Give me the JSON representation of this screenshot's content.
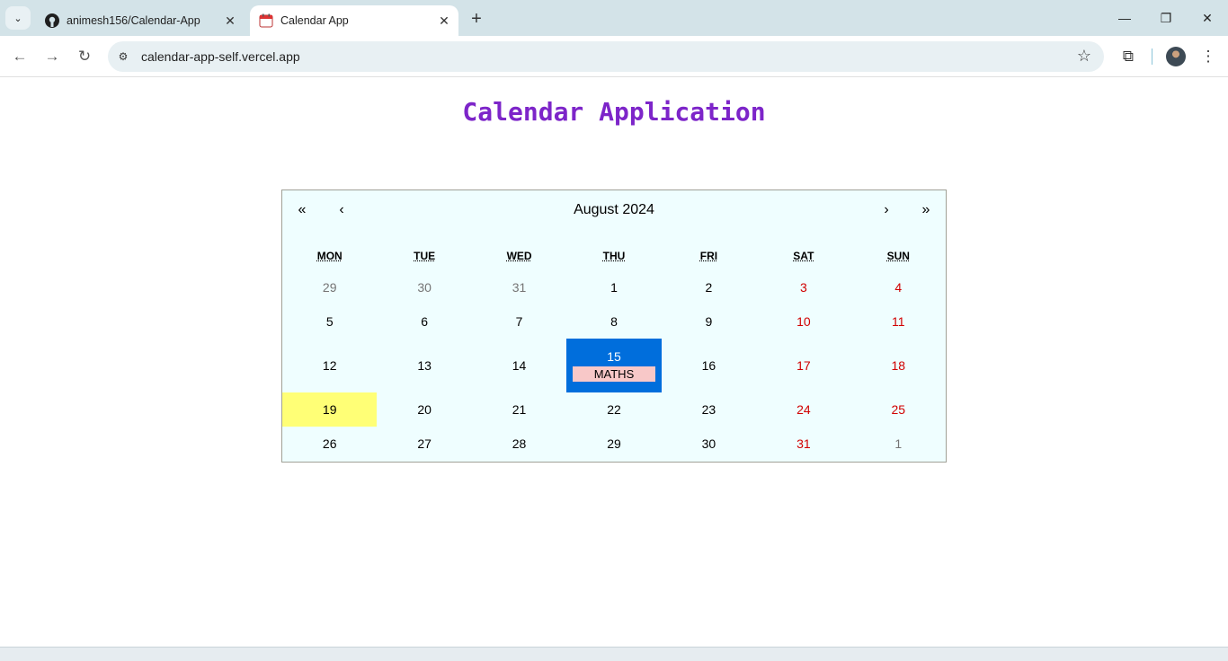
{
  "browser": {
    "tabs": [
      {
        "title": "animesh156/Calendar-App",
        "icon": "github-icon",
        "active": false
      },
      {
        "title": "Calendar App",
        "icon": "calendar-icon",
        "active": true
      }
    ],
    "url": "calendar-app-self.vercel.app"
  },
  "page": {
    "title": "Calendar Application"
  },
  "calendar": {
    "nav": {
      "prev_year": "«",
      "prev_month": "‹",
      "label": "August 2024",
      "next_month": "›",
      "next_year": "»"
    },
    "weekdays": [
      "MON",
      "TUE",
      "WED",
      "THU",
      "FRI",
      "SAT",
      "SUN"
    ],
    "weeks": [
      [
        {
          "d": "29",
          "neighbor": true,
          "weekend": false
        },
        {
          "d": "30",
          "neighbor": true,
          "weekend": false
        },
        {
          "d": "31",
          "neighbor": true,
          "weekend": false
        },
        {
          "d": "1",
          "neighbor": false,
          "weekend": false
        },
        {
          "d": "2",
          "neighbor": false,
          "weekend": false
        },
        {
          "d": "3",
          "neighbor": false,
          "weekend": true
        },
        {
          "d": "4",
          "neighbor": false,
          "weekend": true
        }
      ],
      [
        {
          "d": "5",
          "neighbor": false,
          "weekend": false
        },
        {
          "d": "6",
          "neighbor": false,
          "weekend": false
        },
        {
          "d": "7",
          "neighbor": false,
          "weekend": false
        },
        {
          "d": "8",
          "neighbor": false,
          "weekend": false
        },
        {
          "d": "9",
          "neighbor": false,
          "weekend": false
        },
        {
          "d": "10",
          "neighbor": false,
          "weekend": true
        },
        {
          "d": "11",
          "neighbor": false,
          "weekend": true
        }
      ],
      [
        {
          "d": "12",
          "neighbor": false,
          "weekend": false
        },
        {
          "d": "13",
          "neighbor": false,
          "weekend": false
        },
        {
          "d": "14",
          "neighbor": false,
          "weekend": false
        },
        {
          "d": "15",
          "neighbor": false,
          "weekend": false,
          "active": true,
          "event": "MATHS"
        },
        {
          "d": "16",
          "neighbor": false,
          "weekend": false
        },
        {
          "d": "17",
          "neighbor": false,
          "weekend": true
        },
        {
          "d": "18",
          "neighbor": false,
          "weekend": true
        }
      ],
      [
        {
          "d": "19",
          "neighbor": false,
          "weekend": false,
          "today": true
        },
        {
          "d": "20",
          "neighbor": false,
          "weekend": false
        },
        {
          "d": "21",
          "neighbor": false,
          "weekend": false
        },
        {
          "d": "22",
          "neighbor": false,
          "weekend": false
        },
        {
          "d": "23",
          "neighbor": false,
          "weekend": false
        },
        {
          "d": "24",
          "neighbor": false,
          "weekend": true
        },
        {
          "d": "25",
          "neighbor": false,
          "weekend": true
        }
      ],
      [
        {
          "d": "26",
          "neighbor": false,
          "weekend": false
        },
        {
          "d": "27",
          "neighbor": false,
          "weekend": false
        },
        {
          "d": "28",
          "neighbor": false,
          "weekend": false
        },
        {
          "d": "29",
          "neighbor": false,
          "weekend": false
        },
        {
          "d": "30",
          "neighbor": false,
          "weekend": false
        },
        {
          "d": "31",
          "neighbor": false,
          "weekend": true
        },
        {
          "d": "1",
          "neighbor": true,
          "weekend": false
        }
      ]
    ]
  },
  "colors": {
    "title": "#7d25c9",
    "calendar_bg": "#effeff",
    "weekend": "#d10000",
    "neighbor": "#757575",
    "today": "#ffff76",
    "active": "#006edc",
    "event": "#f8c8c8"
  }
}
